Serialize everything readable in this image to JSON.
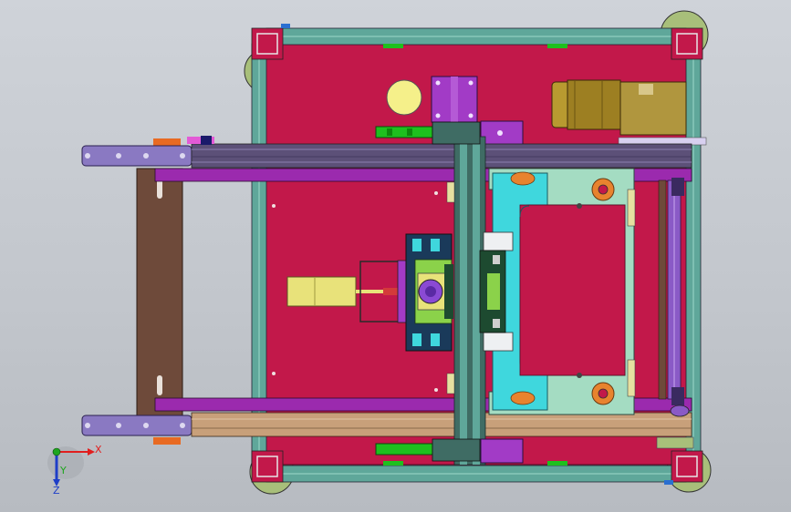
{
  "viewport": {
    "background_top": "#cfd3d9",
    "background_bottom": "#b7bbc1"
  },
  "colors": {
    "base_plate": "#c2184a",
    "aluminium_frame": "#5fa79a",
    "cyan_fixture": "#3fd7dd",
    "pale_green_fixture": "#a4dcc2",
    "purple_block": "#a23bc6",
    "lavender_bar": "#8a79c2",
    "brown_bracket": "#6e4a3a",
    "yellow_cylinder": "#e8e27a",
    "motor_gold": "#9d7f22",
    "green_clamp": "#1ec01e",
    "foot_green": "#a8bf7a",
    "tan_rail": "#c8a07a"
  },
  "triad": {
    "x_label": "X",
    "y_label": "Y",
    "z_label": "Z",
    "x_color": "#e11e1e",
    "y_color": "#1ea51e",
    "z_color": "#1e3ec8"
  }
}
